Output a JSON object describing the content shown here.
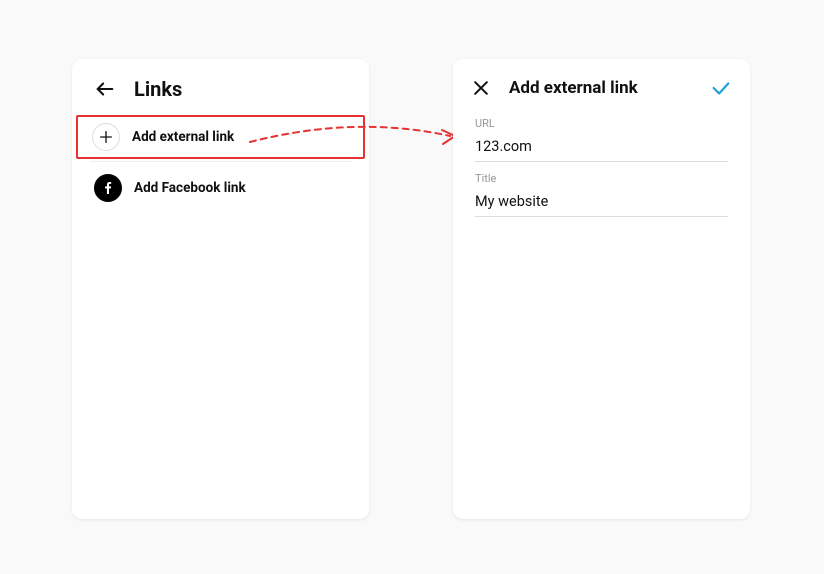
{
  "left_panel": {
    "title": "Links",
    "items": [
      {
        "label": "Add external link"
      },
      {
        "label": "Add Facebook link"
      }
    ]
  },
  "right_panel": {
    "title": "Add external link",
    "fields": {
      "url": {
        "label": "URL",
        "value": "123.com"
      },
      "title": {
        "label": "Title",
        "value": "My website"
      }
    }
  }
}
